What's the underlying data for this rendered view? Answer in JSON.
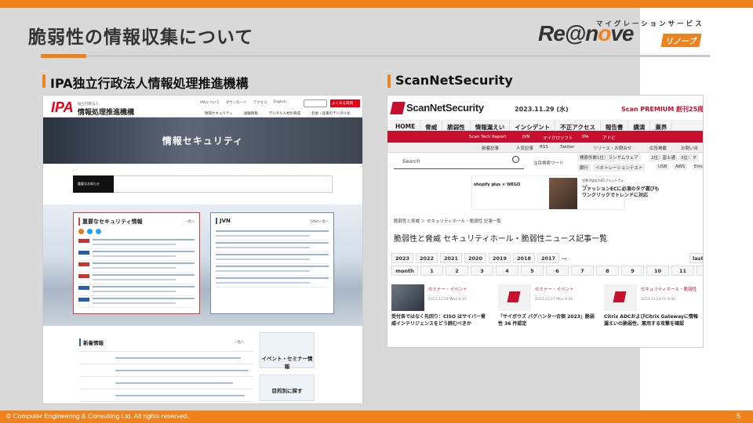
{
  "slide": {
    "title": "脆弱性の情報収集について",
    "footer_copyright": "© Computer Engineering & Consulting Ltd. All rights reserved.",
    "page_number": "5",
    "accent_color": "#f0821e"
  },
  "logo": {
    "tagline": "マイグレーションサービス",
    "main_prefix": "Re@n",
    "main_o": "o",
    "main_suffix": "ve",
    "tag": "リノーブ"
  },
  "sections": {
    "left_heading": "IPA独立行政法人情報処理推進機構",
    "right_heading": "ScanNetSecurity"
  },
  "ipa": {
    "logo_text": "IPA",
    "org_small": "独立行政法人",
    "org_name": "情報処理推進機構",
    "header_links": [
      "IPAについて",
      "ダウンロード",
      "アクセス",
      "English"
    ],
    "header_button": "よくある質問",
    "subnav": [
      "情報セキュリティ",
      "試験情報",
      "デジタル人材の育成",
      "社会・産業のデジタル化"
    ],
    "hero_title": "情報セキュリティ",
    "notice_button": "重要なお知らせ",
    "card1_title": "重要なセキュリティ情報",
    "card1_more": "一覧へ",
    "card2_title": "JVN",
    "card2_more": "JVNの一覧へ",
    "new_title": "新着情報",
    "new_more": "一覧へ",
    "event_label": "イベント・セミナー情報",
    "purpose_label": "目的別に探す"
  },
  "sns": {
    "site_name": "ScanNetSecurity",
    "date": "2023.11.29 (水)",
    "premium": "Scan PREMIUM 創刊25周年",
    "nav": [
      "HOME",
      "脅威",
      "脆弱性",
      "情報漏えい",
      "インシデント",
      "不正アクセス",
      "報告書",
      "講演",
      "業界"
    ],
    "tags": [
      "Scan Tech Report",
      "JVN",
      "マイクロソフト",
      "IPA",
      "アドビ"
    ],
    "subnav": [
      "新着記事",
      "人気記事",
      "RSS",
      "Twitter",
      "リリース・お問合せ",
      "広告掲載",
      "お問い合"
    ],
    "search_placeholder": "Search",
    "hot_keyword_label": "注目検索ワード",
    "keywords": [
      "検索件数1位：ランサムウェア",
      "2位：富士通",
      "3位：マ",
      "銀行",
      "ペネトレーションテスト",
      "USB",
      "AWS",
      "Emo"
    ],
    "ad_brands": "shopify plus × WEGO",
    "ad_sub": "世界が認めたECプラットフォーム",
    "ad_copy": "ファッションECに必須のタグ選びもワンクリックでトレンドに対応",
    "breadcrumb": "脆弱性と脅威 ＞ セキュリティホール・脆弱性 記事一覧",
    "page_title": "脆弱性と脅威 セキュリティホール・脆弱性ニュース記事一覧",
    "years": [
      "2023",
      "2022",
      "2021",
      "2020",
      "2019",
      "2018",
      "2017",
      "…",
      "last »"
    ],
    "months": [
      "month",
      "1",
      "2",
      "3",
      "4",
      "5",
      "6",
      "7",
      "8",
      "9",
      "10",
      "11",
      "12"
    ],
    "articles": [
      {
        "category": "セミナー・イベント",
        "date": "2023.11.29 Wed 8:15",
        "headline": "受付各ではなく先回り：CISO はサイバー脅威インテリジェンスをどう読むべきか"
      },
      {
        "category": "セミナー・イベント",
        "date": "2023.11.27 Mon 8:00",
        "headline": "「サイボウズ バグハンター合宿 2023」脆弱性 36 件認定"
      },
      {
        "category": "セキュリティホール・脆弱性",
        "date": "2023.11.24 Fri 8:00",
        "headline": "Citrix ADCおよびCitrix Gatewayに情報漏えいの脆弱性、悪用する攻撃を確認"
      }
    ]
  }
}
